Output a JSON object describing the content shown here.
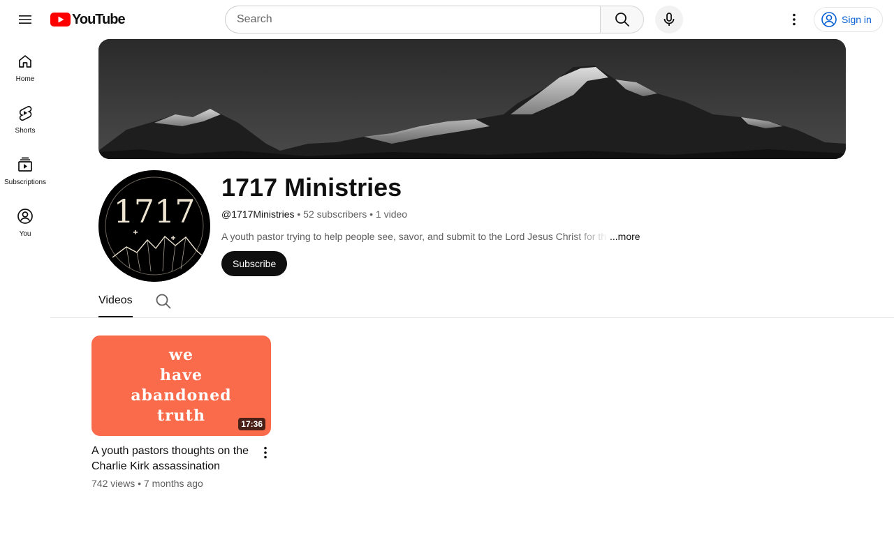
{
  "header": {
    "logo_text": "YouTube",
    "search_placeholder": "Search",
    "signin_label": "Sign in",
    "brand_color": "#ff0000",
    "link_color": "#065fd4"
  },
  "guide": {
    "items": [
      {
        "label": "Home",
        "icon": "home-icon"
      },
      {
        "label": "Shorts",
        "icon": "shorts-icon"
      },
      {
        "label": "Subscriptions",
        "icon": "subscriptions-icon"
      },
      {
        "label": "You",
        "icon": "account-icon"
      }
    ]
  },
  "channel": {
    "name": "1717 Ministries",
    "handle": "@1717Ministries",
    "subscribers": "52 subscribers",
    "videos_count": "1 video",
    "separator": " • ",
    "description": "A youth pastor trying to help people see, savor, and submit to the Lord Jesus Christ for th",
    "more_label": "...more",
    "subscribe_label": "Subscribe",
    "avatar_text": "1717"
  },
  "tabs": {
    "videos_label": "Videos"
  },
  "videos": [
    {
      "thumbnail_lines": [
        "we",
        "have",
        "abandoned",
        "truth"
      ],
      "thumbnail_color": "#fa6b4b",
      "duration": "17:36",
      "title": "A youth pastors thoughts on the Charlie Kirk assassination",
      "views": "742 views",
      "age": "7 months ago",
      "meta": "742 views • 7 months ago"
    }
  ]
}
